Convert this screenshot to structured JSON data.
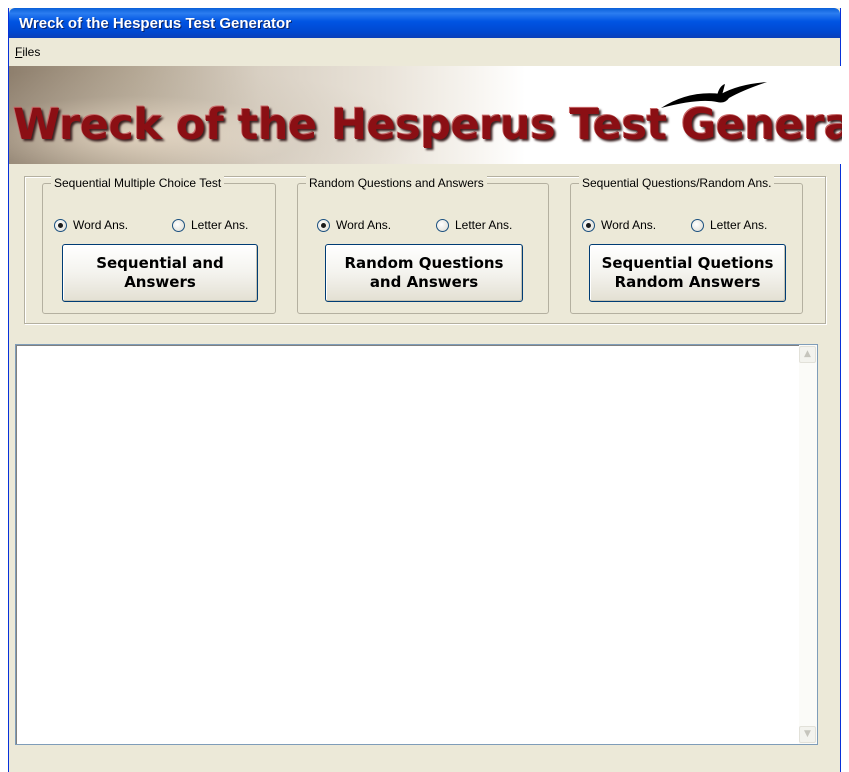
{
  "window": {
    "title": "Wreck of the Hesperus Test Generator"
  },
  "menu": {
    "files_accel": "F",
    "files_rest": "iles"
  },
  "banner": {
    "title": "Wreck of the Hesperus Test Generator"
  },
  "groups": [
    {
      "label": "Sequential Multiple Choice Test",
      "radio_word": "Word Ans.",
      "radio_letter": "Letter Ans.",
      "selected": "word",
      "button": "Sequential and\nAnswers"
    },
    {
      "label": "Random Questions and Answers",
      "radio_word": "Word Ans.",
      "radio_letter": "Letter Ans.",
      "selected": "word",
      "button": "Random Questions\nand Answers"
    },
    {
      "label": "Sequential Questions/Random Ans.",
      "radio_word": "Word Ans.",
      "radio_letter": "Letter Ans.",
      "selected": "word",
      "button": "Sequential Quetions\nRandom Answers"
    }
  ],
  "output": {
    "value": ""
  }
}
